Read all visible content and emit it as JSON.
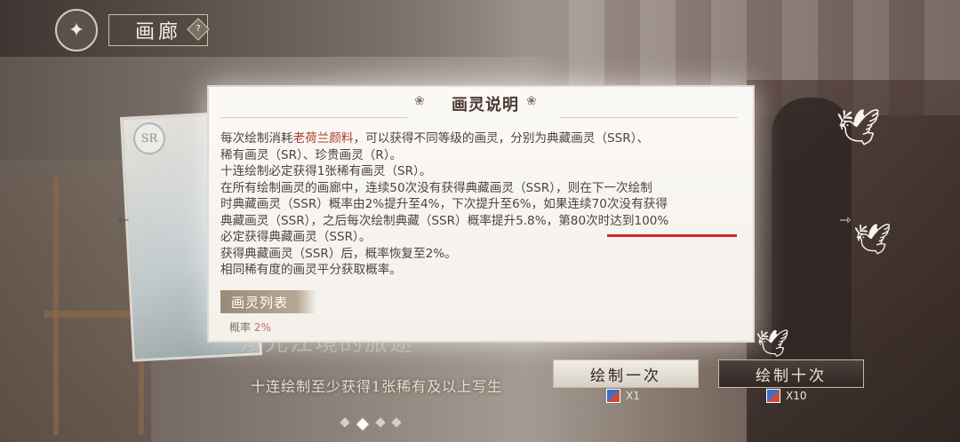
{
  "header": {
    "title": "画廊",
    "help_label": "?"
  },
  "card": {
    "rarity_badge": "SR"
  },
  "dialog": {
    "title": "画灵说明",
    "paragraphs": {
      "line1_pre": "每次绘制消耗",
      "line1_highlight": "老荷兰颜料",
      "line1_post": "，可以获得不同等级的画灵，分别为典藏画灵（SSR）、",
      "line2": "稀有画灵（SR）、珍贵画灵（R）。",
      "line3": "十连绘制必定获得1张稀有画灵（SR）。",
      "line4": "在所有绘制画灵的画廊中，连续50次没有获得典藏画灵（SSR），则在下一次绘制",
      "line5": "时典藏画灵（SSR）概率由2%提升至4%，下次提升至6%，如果连续70次没有获得",
      "line6": "典藏画灵（SSR），之后每次绘制典藏（SSR）概率提升5.8%，第80次时达到100%",
      "line7": "必定获得典藏画灵（SSR）。",
      "line8": "获得典藏画灵（SSR）后，概率恢复至2%。",
      "line9": "相同稀有度的画灵平分获取概率。"
    },
    "list_tab": "画灵列表",
    "list_peek_prefix": "概率",
    "list_peek_rate": "2%"
  },
  "bottom": {
    "hint": "十连绘制至少获得1张稀有及以上写生",
    "draw_once_label": "绘制一次",
    "draw_once_cost": "X1",
    "draw_ten_label": "绘制十次",
    "draw_ten_cost": "X10"
  },
  "colors": {
    "highlight": "#b03a2e",
    "underline": "#d8282b"
  }
}
